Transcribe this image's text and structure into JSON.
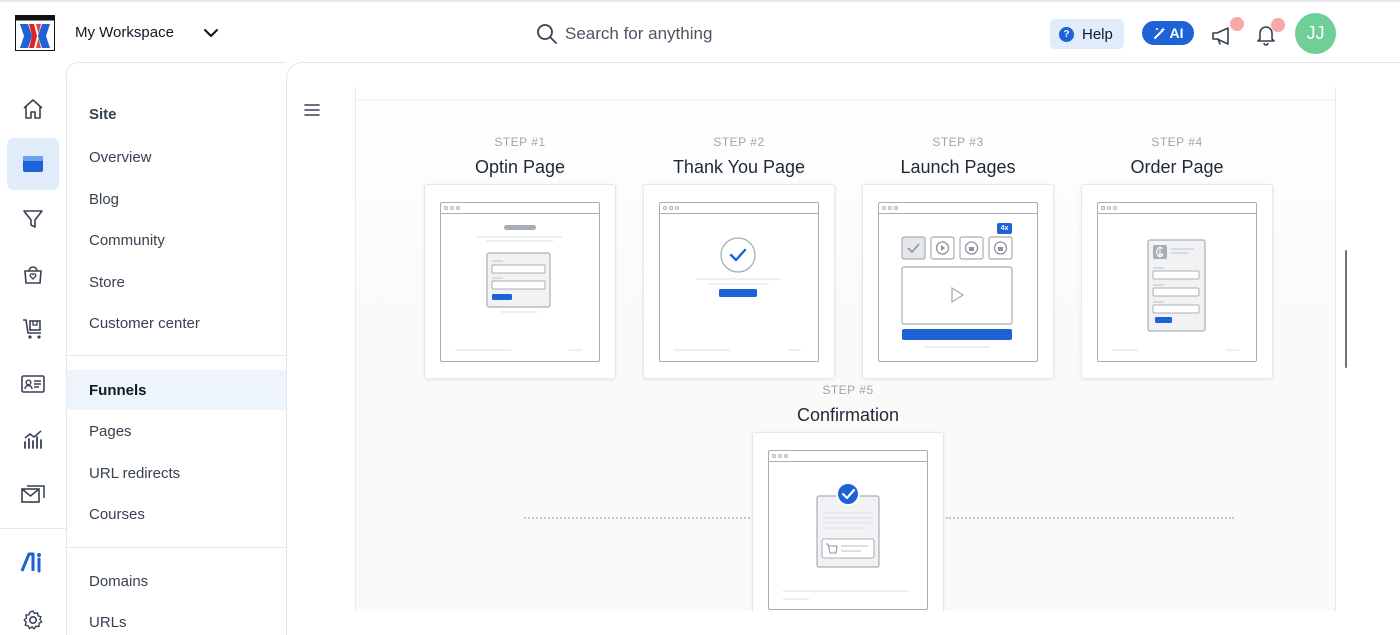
{
  "header": {
    "workspace_name": "My Workspace",
    "search_placeholder": "Search for anything",
    "help_label": "Help",
    "ai_label": "AI",
    "avatar_initials": "JJ"
  },
  "sidebar": {
    "section_title": "Site",
    "items": [
      {
        "label": "Overview"
      },
      {
        "label": "Blog"
      },
      {
        "label": "Community"
      },
      {
        "label": "Store"
      },
      {
        "label": "Customer center"
      },
      {
        "label": "Funnels"
      },
      {
        "label": "Pages"
      },
      {
        "label": "URL redirects"
      },
      {
        "label": "Courses"
      },
      {
        "label": "Domains"
      },
      {
        "label": "URLs"
      }
    ],
    "active_item": "Funnels"
  },
  "funnel": {
    "steps": [
      {
        "number": "STEP #1",
        "title": "Optin Page"
      },
      {
        "number": "STEP #2",
        "title": "Thank You Page"
      },
      {
        "number": "STEP #3",
        "title": "Launch Pages",
        "badge": "4x"
      },
      {
        "number": "STEP #4",
        "title": "Order Page"
      },
      {
        "number": "STEP #5",
        "title": "Confirmation"
      }
    ]
  },
  "colors": {
    "accent": "#1d62d6",
    "avatar": "#6fcf97",
    "notification_dot": "#f9a8a8",
    "active_bg": "#e1ecfa"
  },
  "icons": [
    "home-icon",
    "site-icon",
    "funnel-icon",
    "store-icon",
    "cart-icon",
    "contacts-icon",
    "analytics-icon",
    "email-icon",
    "ai-icon",
    "settings-icon"
  ]
}
